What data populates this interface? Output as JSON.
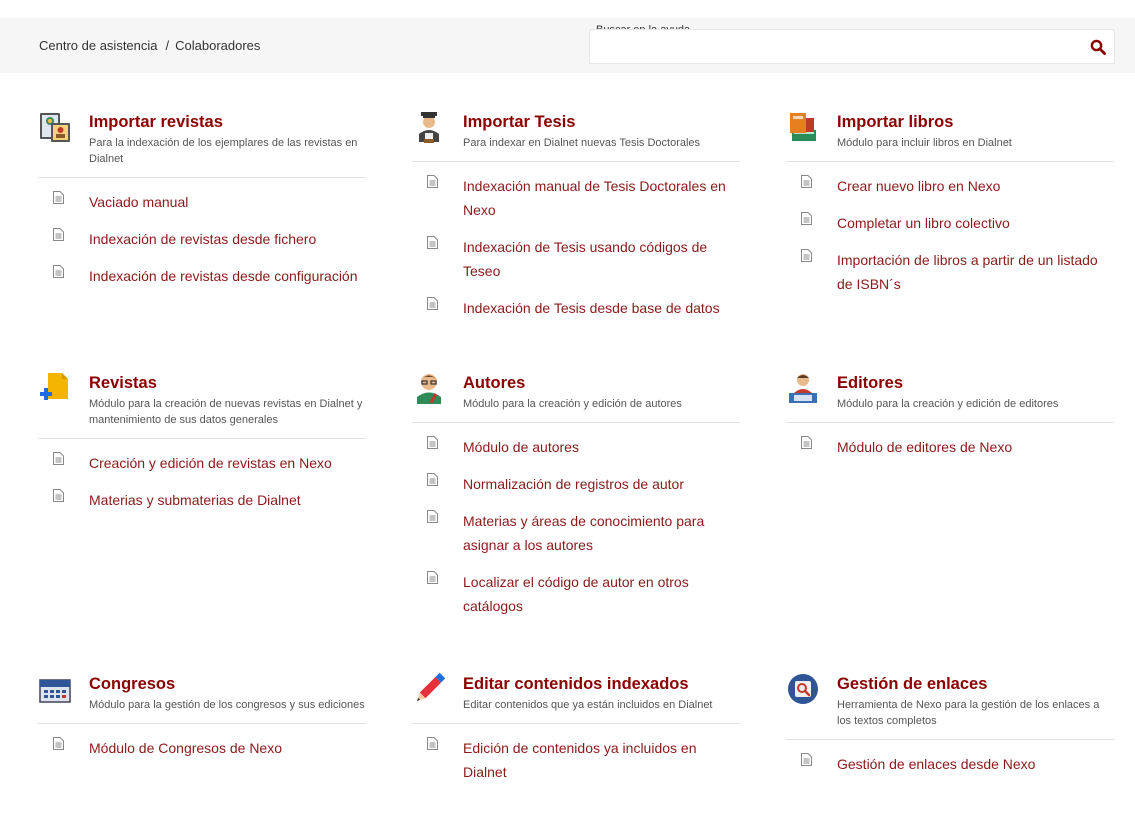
{
  "header": {
    "breadcrumb": [
      "Centro de asistencia",
      "/",
      "Colaboradores"
    ],
    "search": {
      "label": "Buscar en la ayuda",
      "value": "",
      "placeholder": ""
    }
  },
  "cards": [
    {
      "title": "Importar revistas",
      "desc": "Para la indexación de los ejemplares de las revistas en Dialnet",
      "icon": "magazines-icon",
      "links": [
        "Vaciado manual",
        "Indexación de revistas desde fichero",
        "Indexación de revistas desde configuración"
      ]
    },
    {
      "title": "Importar Tesis",
      "desc": "Para indexar en Dialnet nuevas Tesis Doctorales",
      "icon": "graduate-icon",
      "links": [
        "Indexación manual de Tesis Doctorales en Nexo",
        "Indexación de Tesis usando códigos de Teseo",
        "Indexación de Tesis desde base de datos"
      ]
    },
    {
      "title": "Importar libros",
      "desc": "Módulo para incluir libros en Dialnet",
      "icon": "books-icon",
      "links": [
        "Crear nuevo libro en Nexo",
        "Completar un libro colectivo",
        "Importación de libros a partir de un listado de ISBN´s"
      ]
    },
    {
      "title": "Revistas",
      "desc": "Módulo para la creación de nuevas revistas en Dialnet y mantenimiento de sus datos generales",
      "icon": "add-document-icon",
      "links": [
        "Creación y edición de revistas en Nexo",
        "Materias y submaterias de Dialnet"
      ]
    },
    {
      "title": "Autores",
      "desc": "Módulo para la creación y edición de autores",
      "icon": "author-icon",
      "links": [
        "Módulo de autores",
        "Normalización de registros de autor",
        "Materias y áreas de conocimiento para asignar a los autores",
        "Localizar el código de autor en otros catálogos"
      ]
    },
    {
      "title": "Editores",
      "desc": "Módulo para la creación y edición de editores",
      "icon": "editor-icon",
      "links": [
        "Módulo de editores de Nexo"
      ]
    },
    {
      "title": "Congresos",
      "desc": "Módulo para la gestión de los congresos y sus ediciones",
      "icon": "calendar-icon",
      "links": [
        "Módulo de Congresos de Nexo"
      ]
    },
    {
      "title": "Editar contenidos indexados",
      "desc": "Editar contenidos que ya están incluidos en Dialnet",
      "icon": "pencil-icon",
      "links": [
        "Edición de contenidos ya incluidos en Dialnet"
      ]
    },
    {
      "title": "Gestión de enlaces",
      "desc": "Herramienta de Nexo para la gestión de los enlaces a los textos completos",
      "icon": "link-management-icon",
      "links": [
        "Gestión de enlaces desde Nexo"
      ]
    }
  ]
}
